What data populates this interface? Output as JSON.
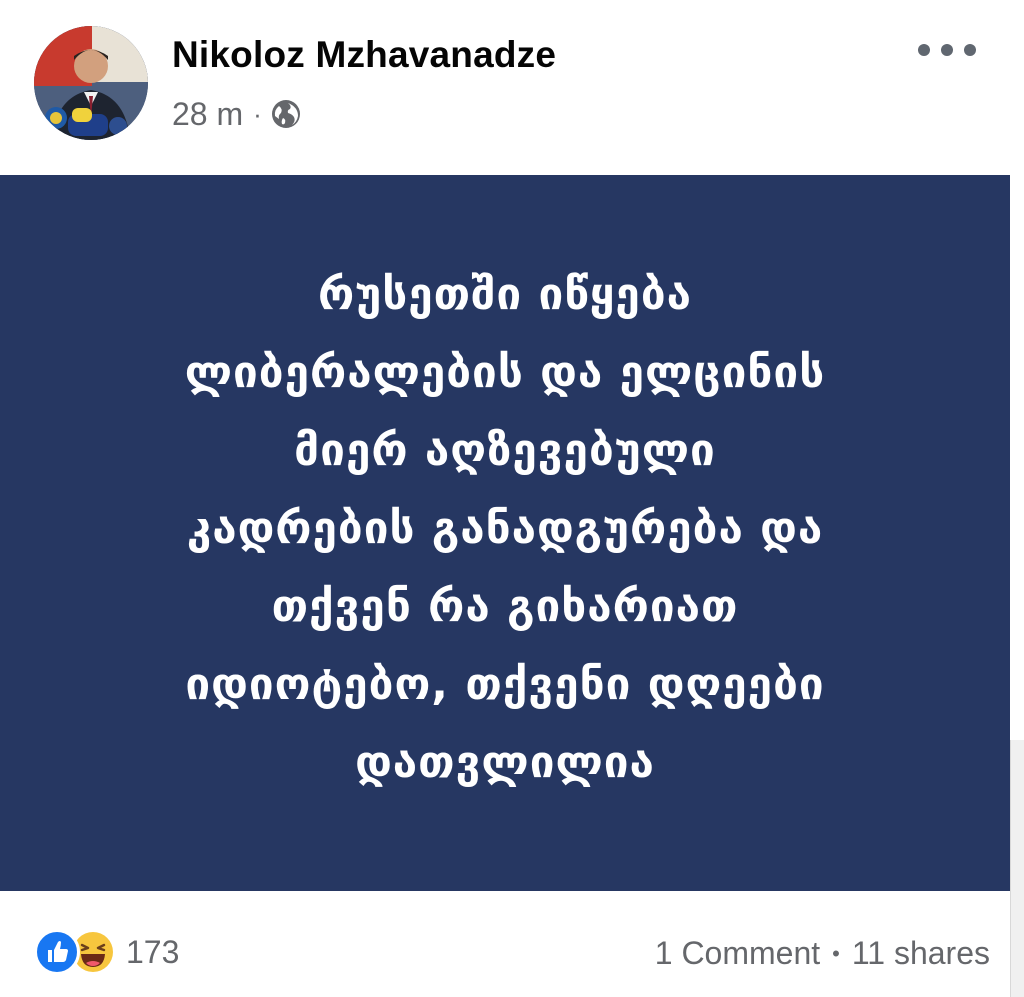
{
  "post": {
    "author": "Nikoloz Mzhavanadze",
    "time": "28 m",
    "meta_separator": "·",
    "privacy_icon": "globe-icon",
    "more_icon": "more-horizontal-icon",
    "avatar_icon": "profile-photo",
    "text_lines": [
      "რუსეთში იწყება",
      "ლიბერალების და ელცინის",
      "მიერ აღზევებული",
      "კადრების განადგურება და",
      "თქვენ რა გიხარიათ",
      "იდიოტებო, თქვენი დღეები",
      "დათვლილია"
    ],
    "background_color": "#263762"
  },
  "footer": {
    "reaction_icons": [
      "like-icon",
      "haha-icon"
    ],
    "reaction_count": "173",
    "comments": "1 Comment",
    "separator": "•",
    "shares": "11 shares"
  }
}
